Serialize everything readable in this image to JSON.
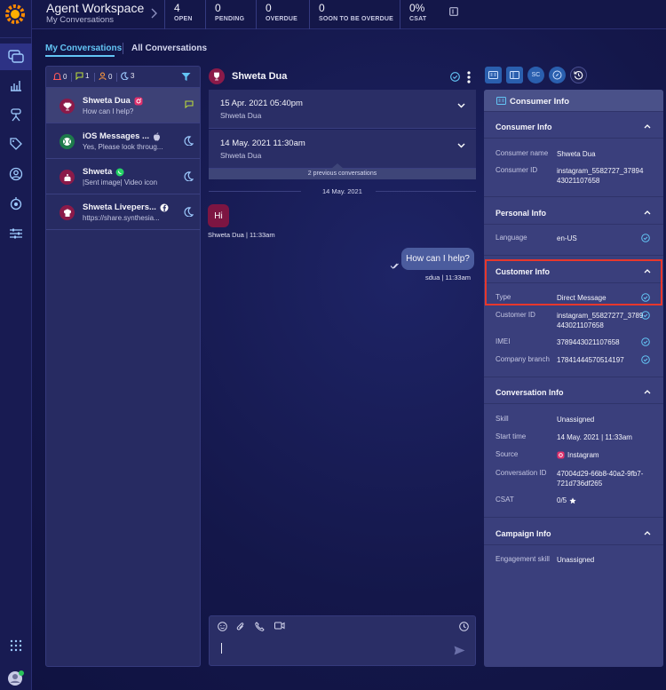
{
  "colors": {
    "accent": "#63c5f5",
    "highlight": "#e8372c",
    "brand": "#ff8a00"
  },
  "header": {
    "title": "Agent Workspace",
    "subtitle": "My Conversations",
    "stats": [
      {
        "value": "4",
        "label": "OPEN"
      },
      {
        "value": "0",
        "label": "PENDING"
      },
      {
        "value": "0",
        "label": "OVERDUE"
      },
      {
        "value": "0",
        "label": "SOON TO BE OVERDUE"
      },
      {
        "value": "0%",
        "label": "CSAT"
      }
    ]
  },
  "tabs": {
    "mine": "My Conversations",
    "all": "All Conversations"
  },
  "filters": {
    "alerts": "0",
    "messages": "1",
    "users": "0",
    "away": "3"
  },
  "conversations": [
    {
      "name": "Shweta Dua",
      "preview": "How can I help?",
      "channel": "instagram",
      "status": "message"
    },
    {
      "name": "iOS Messages ...",
      "preview": "Yes, Please look throug...",
      "channel": "apple",
      "status": "away"
    },
    {
      "name": "Shweta",
      "preview": "|Sent image| Video icon",
      "channel": "whatsapp",
      "status": "away"
    },
    {
      "name": "Shweta Livepers...",
      "preview": "https://share.synthesia...",
      "channel": "facebook",
      "status": "away"
    }
  ],
  "chat": {
    "title": "Shweta Dua",
    "previous": [
      {
        "date": "15 Apr. 2021 05:40pm",
        "name": "Shweta Dua"
      },
      {
        "date": "14 May. 2021 11:30am",
        "name": "Shweta Dua"
      }
    ],
    "previous_count": "2 previous conversations",
    "date_separator": "14 May. 2021",
    "incoming": {
      "text": "Hi",
      "meta": "Shweta Dua  |  11:33am"
    },
    "outgoing": {
      "text": "How can I help?",
      "meta": "sdua  |  11:33am"
    }
  },
  "right_buttons": [
    "SC"
  ],
  "info": {
    "title": "Consumer Info",
    "consumer": {
      "title": "Consumer Info",
      "name_label": "Consumer name",
      "name": "Shweta Dua",
      "id_label": "Consumer ID",
      "id": "instagram_5582727_3789443021107658"
    },
    "personal": {
      "title": "Personal Info",
      "language_label": "Language",
      "language": "en-US"
    },
    "customer": {
      "title": "Customer Info",
      "type_label": "Type",
      "type": "Direct Message",
      "cid_label": "Customer ID",
      "cid": "instagram_55827277_3789443021107658",
      "imei_label": "IMEI",
      "imei": "3789443021107658",
      "branch_label": "Company branch",
      "branch": "17841444570514197"
    },
    "conversation": {
      "title": "Conversation Info",
      "skill_label": "Skill",
      "skill": "Unassigned",
      "start_label": "Start time",
      "start": "14 May. 2021 | 11:33am",
      "source_label": "Source",
      "source": "Instagram",
      "cid_label": "Conversation ID",
      "cid": "47004d29-66b8-40a2-9fb7-721d736df265",
      "csat_label": "CSAT",
      "csat": "0/5"
    },
    "campaign": {
      "title": "Campaign Info",
      "skill_label": "Engagement skill",
      "skill": "Unassigned"
    }
  }
}
